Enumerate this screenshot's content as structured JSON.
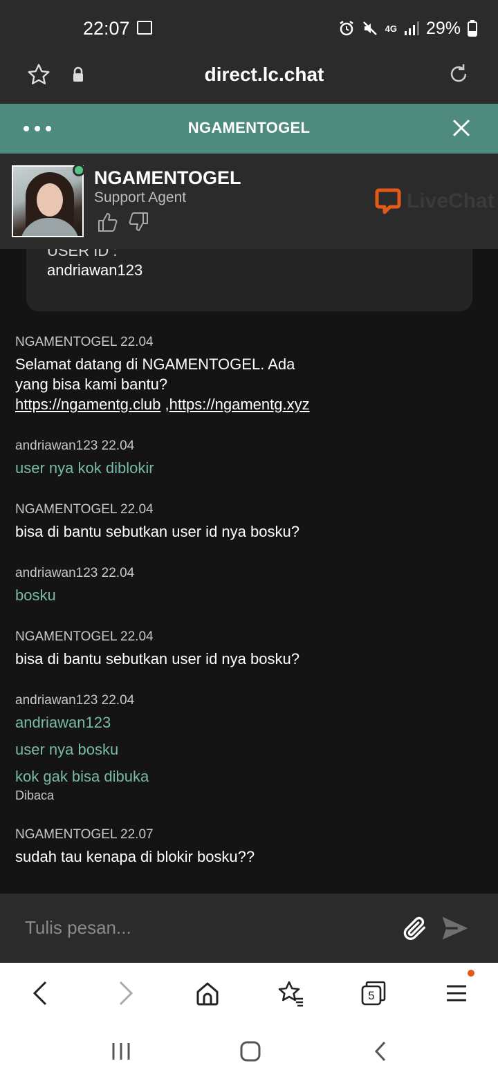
{
  "status_bar": {
    "time": "22:07",
    "network": "4G",
    "battery": "29%"
  },
  "browser": {
    "url": "direct.lc.chat",
    "tabs_count": "5"
  },
  "chat": {
    "topbar_title": "NGAMENTOGEL",
    "agent": {
      "name": "NGAMENTOGEL",
      "role": "Support Agent",
      "status": "online"
    },
    "brand": "LiveChat",
    "form": {
      "label": "USER ID :",
      "value": "andriawan123"
    },
    "messages": [
      {
        "meta": "NGAMENTOGEL 22.04",
        "lines": [
          "Selamat datang di NGAMENTOGEL. Ada",
          "yang bisa kami bantu?"
        ],
        "links": [
          "https://ngamentg.club",
          "https://ngamentg.xyz"
        ],
        "link_sep": " ,"
      },
      {
        "meta": "andriawan123 22.04",
        "lines": [
          "user nya kok diblokir"
        ]
      },
      {
        "meta": "NGAMENTOGEL 22.04",
        "lines": [
          "bisa di bantu sebutkan user id nya bosku?"
        ]
      },
      {
        "meta": "andriawan123 22.04",
        "lines": [
          "bosku"
        ]
      },
      {
        "meta": "NGAMENTOGEL 22.04",
        "lines": [
          "bisa di bantu sebutkan user id nya bosku?"
        ]
      },
      {
        "meta": "andriawan123 22.04",
        "lines": [
          "andriawan123",
          "user nya bosku",
          "kok gak bisa dibuka"
        ],
        "read_status": "Dibaca"
      },
      {
        "meta": "NGAMENTOGEL 22.07",
        "lines": [
          "sudah tau kenapa di blokir bosku??"
        ]
      }
    ],
    "input_placeholder": "Tulis pesan..."
  },
  "colors": {
    "accent": "#4e8a7e",
    "user_text": "#79b9a9",
    "online": "#55c58a",
    "livechat_orange": "#e25a18"
  }
}
